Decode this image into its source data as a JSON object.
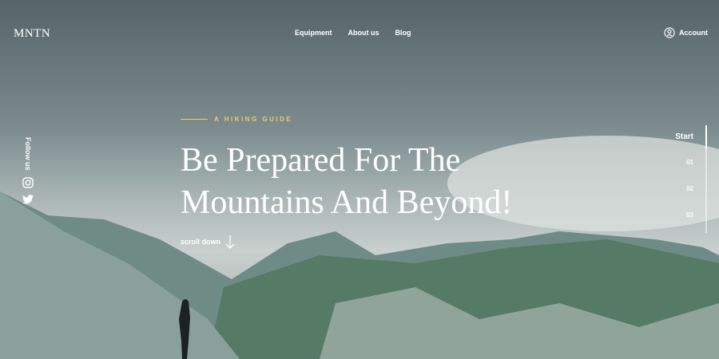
{
  "header": {
    "logo": "MNTN",
    "nav": [
      "Equipment",
      "About us",
      "Blog"
    ],
    "account_label": "Account"
  },
  "social": {
    "label": "Follow us"
  },
  "hero": {
    "eyebrow": "A HIKING GUIDE",
    "title_line1": "Be Prepared For The",
    "title_line2": "Mountains And Beyond!",
    "scroll_label": "scroll down"
  },
  "steps": {
    "items": [
      "Start",
      "01",
      "02",
      "03"
    ],
    "progress": 0.22
  },
  "colors": {
    "accent": "#f2c86b"
  }
}
